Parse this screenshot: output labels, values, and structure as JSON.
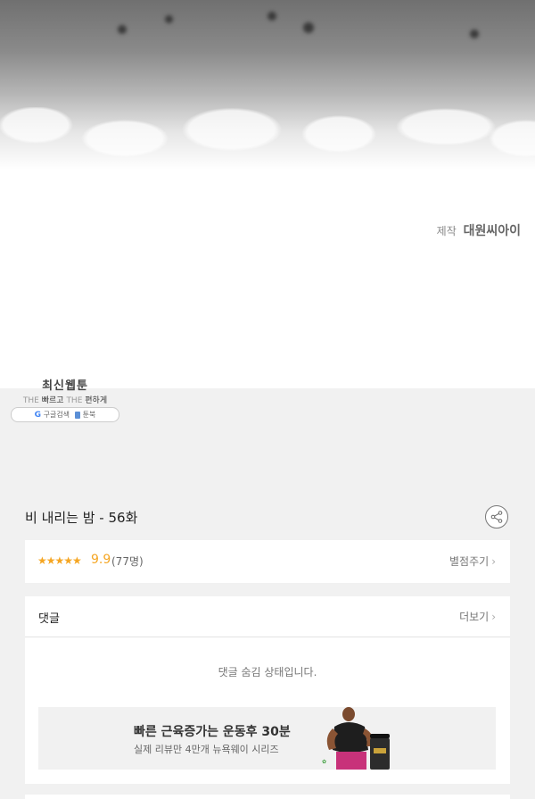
{
  "panel": {
    "credit_prefix": "제작",
    "credit_name": "대원씨아이"
  },
  "promo": {
    "title": "최신웹툰",
    "tagline_faint1": "THE",
    "tagline_bold1": "빠르고",
    "tagline_faint2": "THE",
    "tagline_bold2": "편하게",
    "search_label": "구글검색",
    "book_label": "툰북"
  },
  "episode": {
    "title": "비 내리는 밤 - 56화"
  },
  "rating": {
    "stars": "★★★★★",
    "score": "9.9",
    "count": "(77명)",
    "rate_label": "별점주기"
  },
  "comments": {
    "title": "댓글",
    "more_label": "더보기",
    "hidden_message": "댓글 숨김 상태입니다."
  },
  "ad": {
    "title": "빠른 근육증가는 운동후 30분",
    "subtitle": "실제 리뷰만 4만개 뉴욕웨이 시리즈"
  },
  "colors": {
    "star": "#f5a623",
    "background": "#f1f1f1"
  }
}
